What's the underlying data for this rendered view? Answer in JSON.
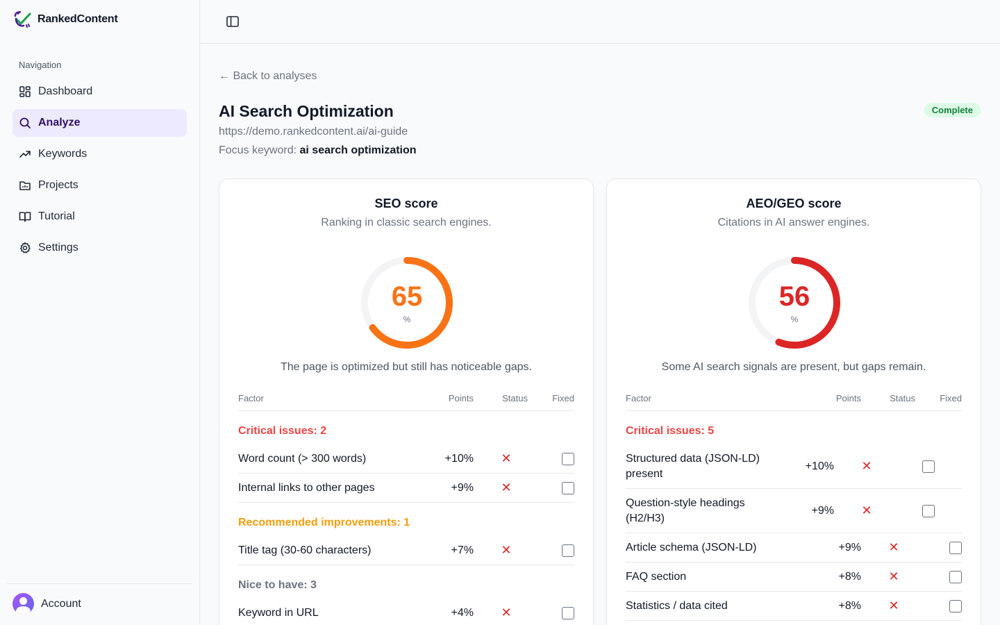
{
  "brand": {
    "name": "RankedContent",
    "logo_icon": "rankedcontent-logo-icon"
  },
  "sidebar": {
    "heading": "Navigation",
    "items": [
      {
        "label": "Dashboard",
        "icon": "dashboard-icon",
        "active": false
      },
      {
        "label": "Analyze",
        "icon": "search-icon",
        "active": true
      },
      {
        "label": "Keywords",
        "icon": "trending-up-icon",
        "active": false
      },
      {
        "label": "Projects",
        "icon": "folder-icon",
        "active": false
      },
      {
        "label": "Tutorial",
        "icon": "book-open-icon",
        "active": false
      },
      {
        "label": "Settings",
        "icon": "gear-icon",
        "active": false
      }
    ],
    "account_label": "Account"
  },
  "page": {
    "back_label": "← Back to analyses",
    "title": "AI Search Optimization",
    "status": "Complete",
    "url": "https://demo.rankedcontent.ai/ai-guide",
    "focus_label": "Focus keyword:",
    "focus_keyword": "ai search optimization"
  },
  "colors": {
    "seo_gauge": "#f97316",
    "aeo_gauge": "#dc2626",
    "gauge_track": "#f3f4f6",
    "critical": "#ef4444",
    "recommended": "#f59e0b",
    "nice": "#6b7280",
    "accent": "#ede9fe"
  },
  "seo": {
    "title": "SEO score",
    "subtitle": "Ranking in classic search engines.",
    "score": 65,
    "unit": "%",
    "summary": "The page is optimized but still has noticeable gaps.",
    "columns": {
      "factor": "Factor",
      "points": "Points",
      "status": "Status",
      "fixed": "Fixed"
    },
    "groups": [
      {
        "label": "Critical issues: 2",
        "kind": "critical",
        "rows": [
          {
            "factor": "Word count (> 300 words)",
            "points": "+10%",
            "status": "✕",
            "fixed": false
          },
          {
            "factor": "Internal links to other pages",
            "points": "+9%",
            "status": "✕",
            "fixed": false
          }
        ]
      },
      {
        "label": "Recommended improvements: 1",
        "kind": "recommended",
        "rows": [
          {
            "factor": "Title tag (30-60 characters)",
            "points": "+7%",
            "status": "✕",
            "fixed": false
          }
        ]
      },
      {
        "label": "Nice to have: 3",
        "kind": "nice",
        "rows": [
          {
            "factor": "Keyword in URL",
            "points": "+4%",
            "status": "✕",
            "fixed": false
          }
        ]
      }
    ]
  },
  "aeo": {
    "title": "AEO/GEO score",
    "subtitle": "Citations in AI answer engines.",
    "score": 56,
    "unit": "%",
    "summary": "Some AI search signals are present, but gaps remain.",
    "columns": {
      "factor": "Factor",
      "points": "Points",
      "status": "Status",
      "fixed": "Fixed"
    },
    "groups": [
      {
        "label": "Critical issues: 5",
        "kind": "critical",
        "rows": [
          {
            "factor": "Structured data (JSON-LD) present",
            "points": "+10%",
            "status": "✕",
            "fixed": false,
            "tall": true
          },
          {
            "factor": "Question-style headings (H2/H3)",
            "points": "+9%",
            "status": "✕",
            "fixed": false,
            "tall": true
          },
          {
            "factor": "Article schema (JSON-LD)",
            "points": "+9%",
            "status": "✕",
            "fixed": false
          },
          {
            "factor": "FAQ section",
            "points": "+8%",
            "status": "✕",
            "fixed": false
          },
          {
            "factor": "Statistics / data cited",
            "points": "+8%",
            "status": "✕",
            "fixed": false
          }
        ]
      }
    ]
  }
}
